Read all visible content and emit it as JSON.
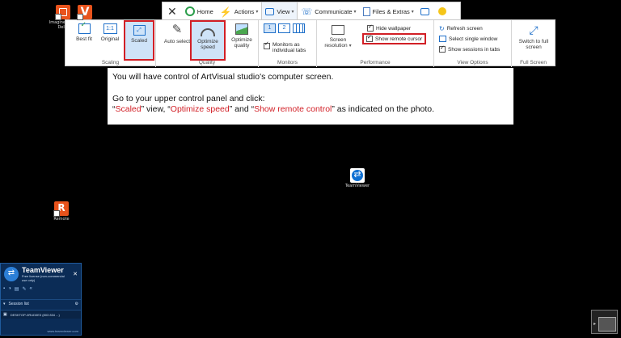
{
  "desktop": {
    "icons": [
      {
        "label": "Imagine Edge Del...",
        "icon": "app-square-icon"
      },
      {
        "label": "",
        "icon": "vectary-v-icon"
      },
      {
        "label": "Remote",
        "icon": "remote-icon"
      },
      {
        "label": "TeamViewer",
        "icon": "teamviewer-icon"
      }
    ]
  },
  "tabs": {
    "home": "Home",
    "actions": "Actions",
    "view": "View",
    "communicate": "Communicate",
    "files": "Files & Extras"
  },
  "ribbon": {
    "scaling": {
      "label": "Scaling",
      "best_fit": "Best fit",
      "original": "Original",
      "scaled": "Scaled"
    },
    "quality": {
      "label": "Quality",
      "auto_select": "Auto select",
      "optimize_speed": "Optimize speed",
      "optimize_quality": "Optimize quality"
    },
    "monitors": {
      "label": "Monitors",
      "m1": "1",
      "m2": "2",
      "individual_tabs": "Monitors as individual tabs"
    },
    "performance": {
      "label": "Performance",
      "screen_resolution": "Screen resolution",
      "hide_wallpaper": "Hide wallpaper",
      "show_remote_cursor": "Show remote cursor"
    },
    "view_options": {
      "label": "View Options",
      "refresh_screen": "Refresh screen",
      "select_single_window": "Select single window",
      "show_sessions_in_tabs": "Show sessions in tabs"
    },
    "full_screen": {
      "label": "Full Screen",
      "switch": "Switch to full screen"
    }
  },
  "instructions": {
    "line1": "You will have control of ArtVisual studio's computer screen.",
    "line2": "Go to your upper control panel and click:",
    "q1": "“",
    "w_scaled": "Scaled",
    "t1": "” view, “",
    "w_optimize": "Optimize speed",
    "t2": "” and “",
    "w_cursor": "Show remote control",
    "t3": "” as indicated on the photo."
  },
  "tvpanel": {
    "title": "TeamViewer",
    "subtitle": "Free license (non-commercial use only)",
    "session_list": "Session list",
    "session_item": "DESKTOP-0RUD0E3 (803 834 ...)",
    "footer": "www.teamviewer.com"
  },
  "colors": {
    "highlight_red": "#d21f26",
    "ribbon_bg": "#ffffff",
    "tv_blue": "#0e6fd2"
  }
}
